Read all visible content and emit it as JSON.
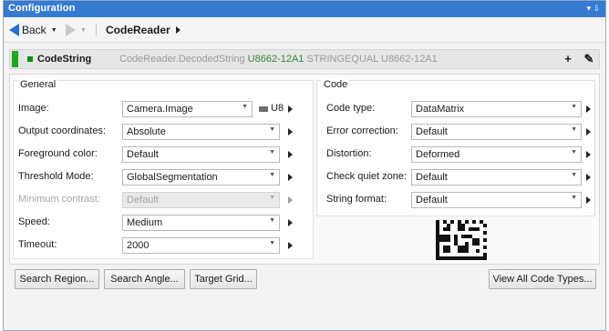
{
  "window": {
    "title": "Configuration",
    "title_buttons": "▾ ⇩"
  },
  "nav": {
    "back_label": "Back",
    "breadcrumb": "CodeReader"
  },
  "tool": {
    "name": "CodeString",
    "expr_prefix": "CodeReader.DecodedString",
    "expr_highlight": "U8662-12A1",
    "expr_suffix": "STRINGEQUAL U8662-12A1",
    "add_label": "+",
    "edit_label": "✎"
  },
  "general": {
    "title": "General",
    "rows": [
      {
        "label": "Image:",
        "value": "Camera.Image",
        "extra": "U8"
      },
      {
        "label": "Output coordinates:",
        "value": "Absolute"
      },
      {
        "label": "Foreground color:",
        "value": "Default"
      },
      {
        "label": "Threshold Mode:",
        "value": "GlobalSegmentation"
      },
      {
        "label": "Minimum contrast:",
        "value": "Default"
      },
      {
        "label": "Speed:",
        "value": "Medium"
      },
      {
        "label": "Timeout:",
        "value": "2000"
      }
    ]
  },
  "code": {
    "title": "Code",
    "rows": [
      {
        "label": "Code type:",
        "value": "DataMatrix"
      },
      {
        "label": "Error correction:",
        "value": "Default"
      },
      {
        "label": "Distortion:",
        "value": "Deformed"
      },
      {
        "label": "Check quiet zone:",
        "value": "Default"
      },
      {
        "label": "String format:",
        "value": "Default"
      }
    ]
  },
  "buttons": {
    "search_region": "Search Region...",
    "search_angle": "Search Angle...",
    "target_grid": "Target Grid...",
    "view_all": "View All Code Types..."
  },
  "colors": {
    "titlebar": "#2f74cc",
    "status_green": "#1ea81e",
    "back_arrow": "#2a6fd1"
  },
  "icons": [
    "back-arrow-icon",
    "forward-arrow-icon",
    "status-square-icon",
    "plus-icon",
    "pencil-icon",
    "datamatrix-preview"
  ]
}
